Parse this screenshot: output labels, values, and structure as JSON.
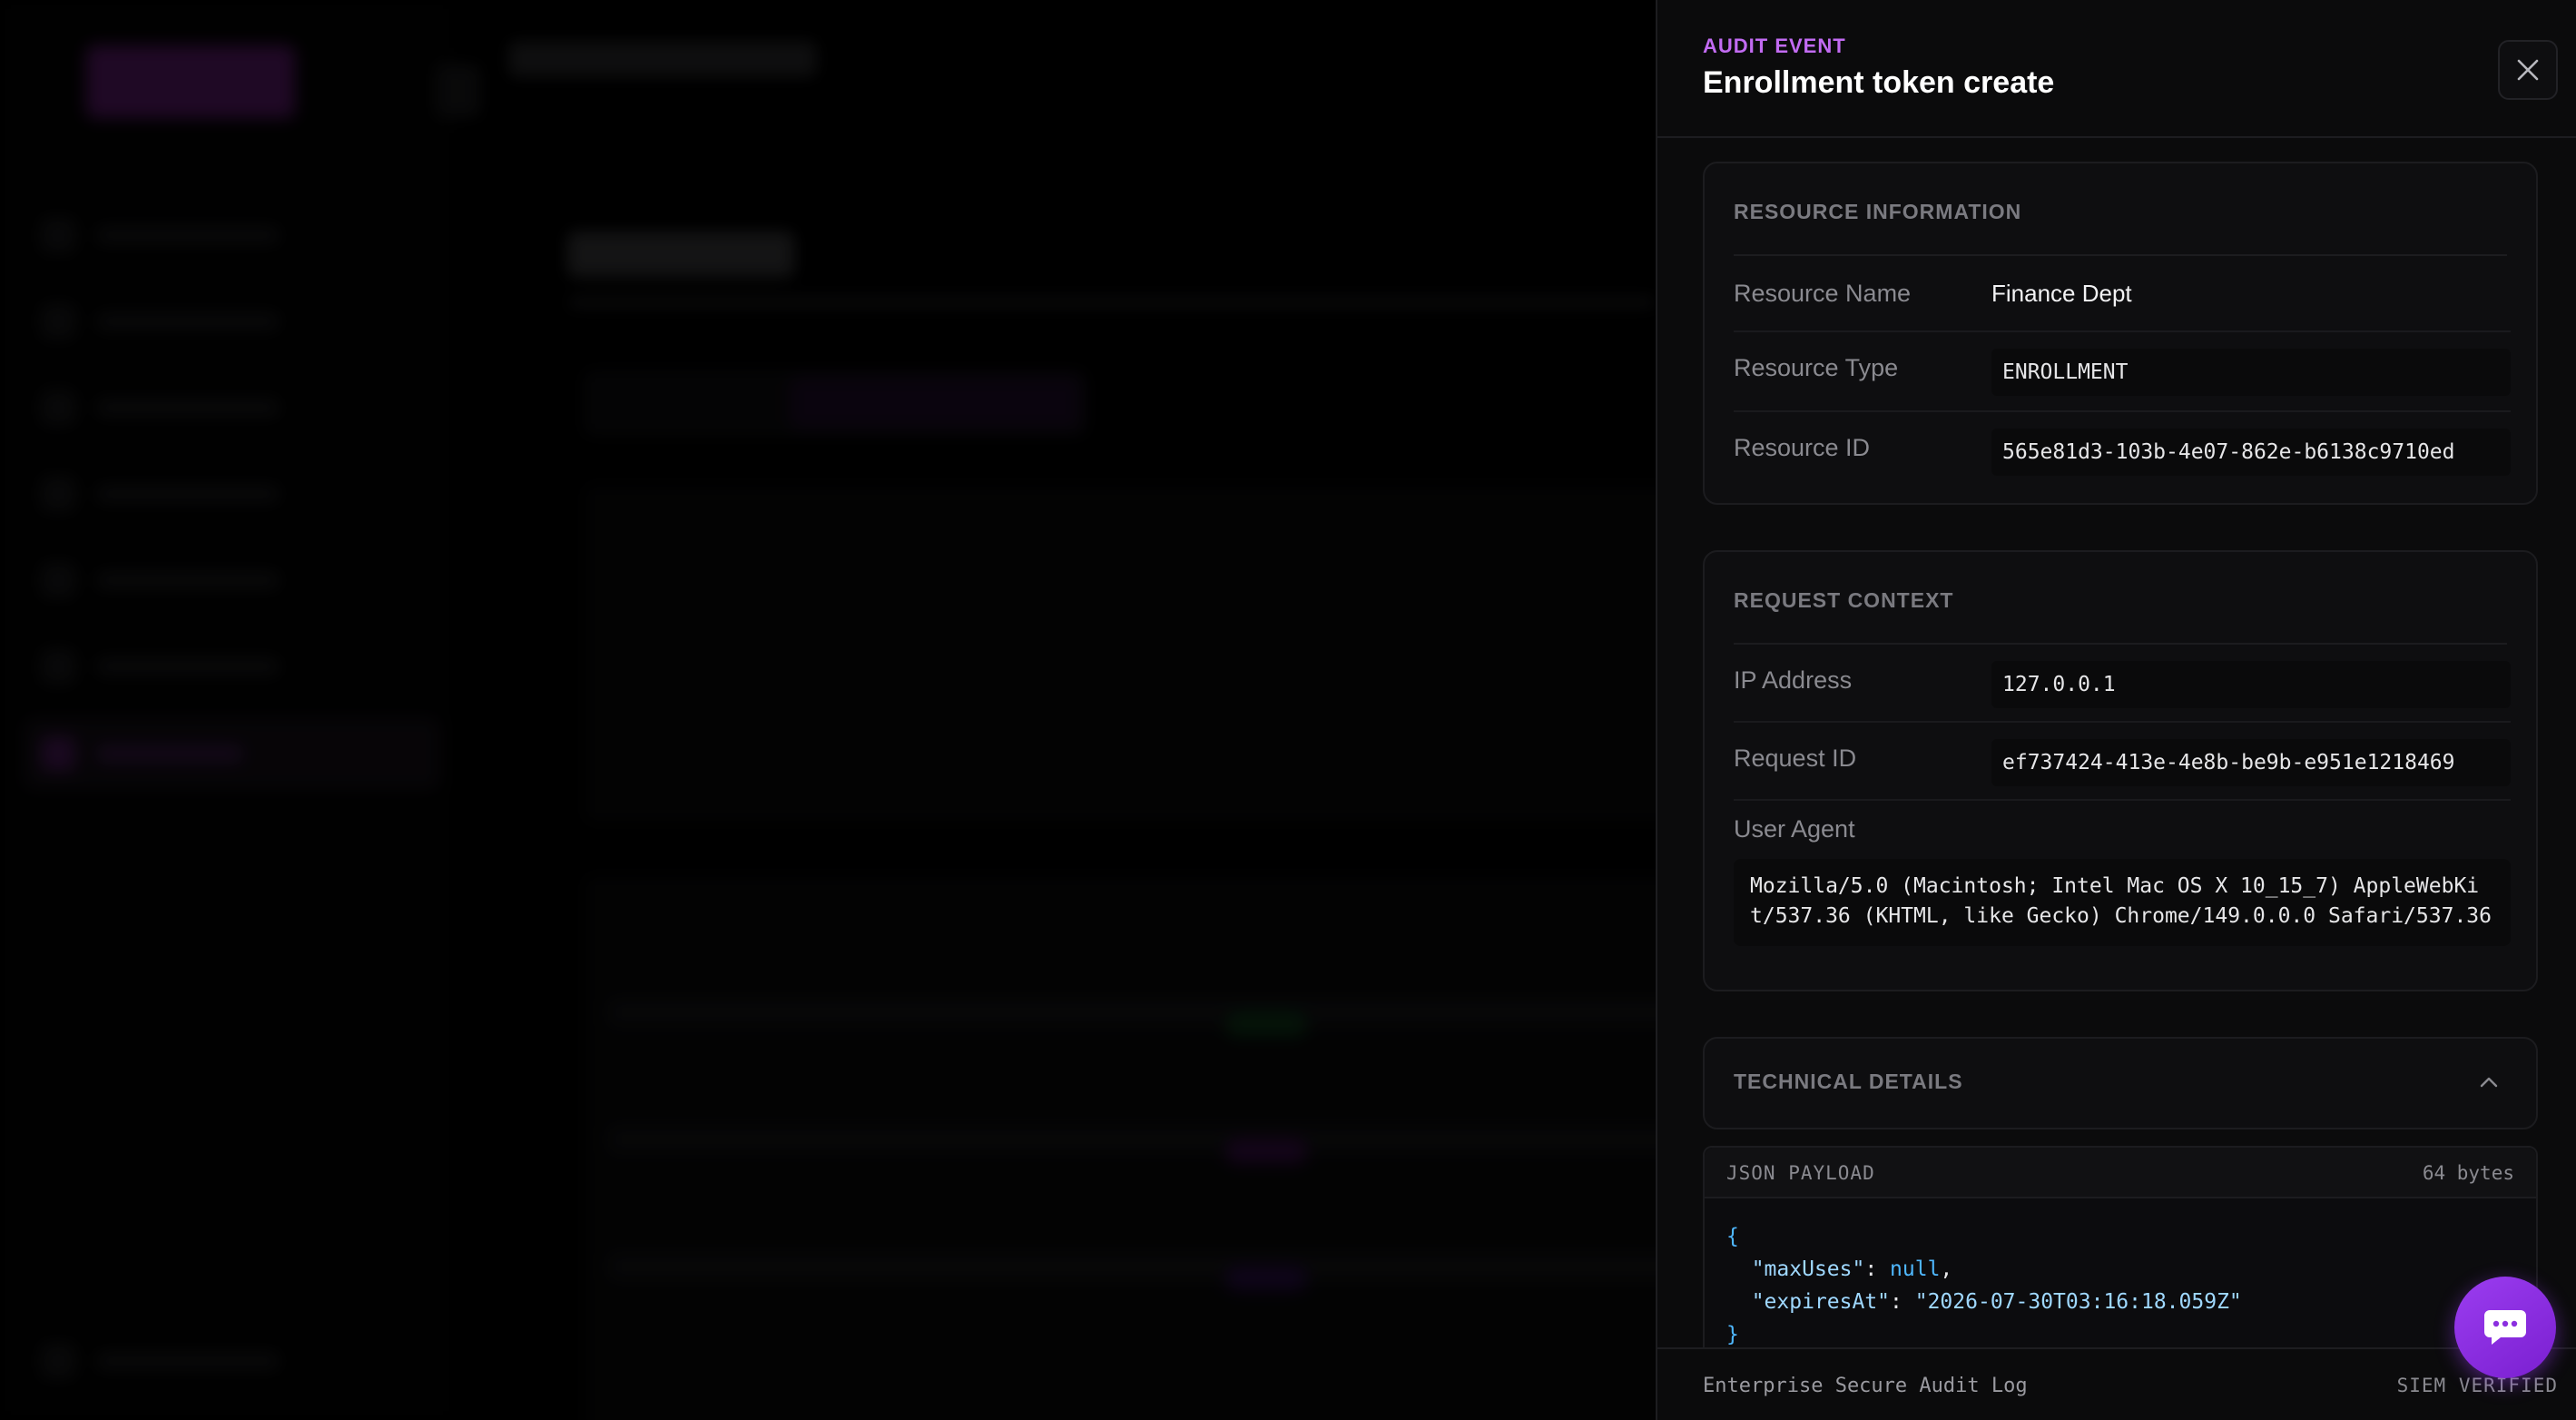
{
  "drawer": {
    "eyebrow": "AUDIT EVENT",
    "title": "Enrollment token create"
  },
  "resource": {
    "section_title": "RESOURCE INFORMATION",
    "name_label": "Resource Name",
    "name_value": "Finance Dept",
    "type_label": "Resource Type",
    "type_value": "ENROLLMENT",
    "id_label": "Resource ID",
    "id_value": "565e81d3-103b-4e07-862e-b6138c9710ed"
  },
  "request": {
    "section_title": "REQUEST CONTEXT",
    "ip_label": "IP Address",
    "ip_value": "127.0.0.1",
    "request_id_label": "Request ID",
    "request_id_value": "ef737424-413e-4e8b-be9b-e951e1218469",
    "ua_label": "User Agent",
    "ua_value": "Mozilla/5.0 (Macintosh; Intel Mac OS X 10_15_7) AppleWebKit/537.36 (KHTML, like Gecko) Chrome/149.0.0.0 Safari/537.36"
  },
  "technical": {
    "section_title": "TECHNICAL DETAILS",
    "expanded": true,
    "payload_label": "JSON PAYLOAD",
    "payload_size": "64 bytes",
    "payload": {
      "open_brace": "{",
      "lines": [
        {
          "key": "\"maxUses\"",
          "sep": ": ",
          "value": "null",
          "trail": ","
        },
        {
          "key": "\"expiresAt\"",
          "sep": ": ",
          "value": "\"2026-07-30T03:16:18.059Z\"",
          "trail": ""
        }
      ],
      "close_brace": "}"
    }
  },
  "footer": {
    "left": "Enterprise Secure Audit Log",
    "right": "SIEM VERIFIED"
  },
  "icons": {
    "close": "close-icon",
    "chevron": "chevron-up-icon",
    "chat": "chat-bubble-icon"
  },
  "colors": {
    "accent": "#c26bf2",
    "fab": "#8b2fe0",
    "json_brace": "#4fb8ff",
    "json_key": "#9fd8ff"
  }
}
